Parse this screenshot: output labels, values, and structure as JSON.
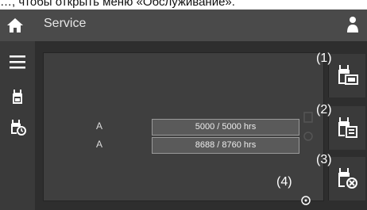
{
  "caption": "…, чтобы открыть меню «Обслуживание».",
  "header": {
    "title": "Service"
  },
  "rows": [
    {
      "label": "A",
      "value": "5000 / 5000 hrs"
    },
    {
      "label": "A",
      "value": "8688 / 8760 hrs"
    }
  ],
  "callouts": [
    "(1)",
    "(2)",
    "(3)",
    "(4)"
  ],
  "colors": {
    "screen_bg": "#2e2e2e",
    "bar_bg": "#4a4a4a",
    "value_box": "#5a5a5a"
  },
  "icons": {
    "home": "home-icon",
    "menu": "menu-icon",
    "user": "user-icon",
    "service": "service-wrench-icon",
    "service_timer": "service-timer-icon",
    "reset": "reset-icon"
  }
}
